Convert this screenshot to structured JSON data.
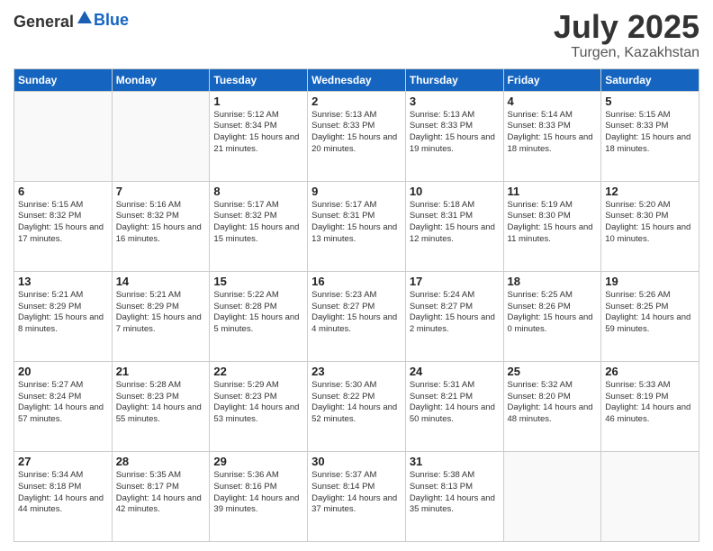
{
  "header": {
    "logo_general": "General",
    "logo_blue": "Blue",
    "month": "July 2025",
    "location": "Turgen, Kazakhstan"
  },
  "days_of_week": [
    "Sunday",
    "Monday",
    "Tuesday",
    "Wednesday",
    "Thursday",
    "Friday",
    "Saturday"
  ],
  "weeks": [
    [
      {
        "day": "",
        "info": ""
      },
      {
        "day": "",
        "info": ""
      },
      {
        "day": "1",
        "info": "Sunrise: 5:12 AM\nSunset: 8:34 PM\nDaylight: 15 hours\nand 21 minutes."
      },
      {
        "day": "2",
        "info": "Sunrise: 5:13 AM\nSunset: 8:33 PM\nDaylight: 15 hours\nand 20 minutes."
      },
      {
        "day": "3",
        "info": "Sunrise: 5:13 AM\nSunset: 8:33 PM\nDaylight: 15 hours\nand 19 minutes."
      },
      {
        "day": "4",
        "info": "Sunrise: 5:14 AM\nSunset: 8:33 PM\nDaylight: 15 hours\nand 18 minutes."
      },
      {
        "day": "5",
        "info": "Sunrise: 5:15 AM\nSunset: 8:33 PM\nDaylight: 15 hours\nand 18 minutes."
      }
    ],
    [
      {
        "day": "6",
        "info": "Sunrise: 5:15 AM\nSunset: 8:32 PM\nDaylight: 15 hours\nand 17 minutes."
      },
      {
        "day": "7",
        "info": "Sunrise: 5:16 AM\nSunset: 8:32 PM\nDaylight: 15 hours\nand 16 minutes."
      },
      {
        "day": "8",
        "info": "Sunrise: 5:17 AM\nSunset: 8:32 PM\nDaylight: 15 hours\nand 15 minutes."
      },
      {
        "day": "9",
        "info": "Sunrise: 5:17 AM\nSunset: 8:31 PM\nDaylight: 15 hours\nand 13 minutes."
      },
      {
        "day": "10",
        "info": "Sunrise: 5:18 AM\nSunset: 8:31 PM\nDaylight: 15 hours\nand 12 minutes."
      },
      {
        "day": "11",
        "info": "Sunrise: 5:19 AM\nSunset: 8:30 PM\nDaylight: 15 hours\nand 11 minutes."
      },
      {
        "day": "12",
        "info": "Sunrise: 5:20 AM\nSunset: 8:30 PM\nDaylight: 15 hours\nand 10 minutes."
      }
    ],
    [
      {
        "day": "13",
        "info": "Sunrise: 5:21 AM\nSunset: 8:29 PM\nDaylight: 15 hours\nand 8 minutes."
      },
      {
        "day": "14",
        "info": "Sunrise: 5:21 AM\nSunset: 8:29 PM\nDaylight: 15 hours\nand 7 minutes."
      },
      {
        "day": "15",
        "info": "Sunrise: 5:22 AM\nSunset: 8:28 PM\nDaylight: 15 hours\nand 5 minutes."
      },
      {
        "day": "16",
        "info": "Sunrise: 5:23 AM\nSunset: 8:27 PM\nDaylight: 15 hours\nand 4 minutes."
      },
      {
        "day": "17",
        "info": "Sunrise: 5:24 AM\nSunset: 8:27 PM\nDaylight: 15 hours\nand 2 minutes."
      },
      {
        "day": "18",
        "info": "Sunrise: 5:25 AM\nSunset: 8:26 PM\nDaylight: 15 hours\nand 0 minutes."
      },
      {
        "day": "19",
        "info": "Sunrise: 5:26 AM\nSunset: 8:25 PM\nDaylight: 14 hours\nand 59 minutes."
      }
    ],
    [
      {
        "day": "20",
        "info": "Sunrise: 5:27 AM\nSunset: 8:24 PM\nDaylight: 14 hours\nand 57 minutes."
      },
      {
        "day": "21",
        "info": "Sunrise: 5:28 AM\nSunset: 8:23 PM\nDaylight: 14 hours\nand 55 minutes."
      },
      {
        "day": "22",
        "info": "Sunrise: 5:29 AM\nSunset: 8:23 PM\nDaylight: 14 hours\nand 53 minutes."
      },
      {
        "day": "23",
        "info": "Sunrise: 5:30 AM\nSunset: 8:22 PM\nDaylight: 14 hours\nand 52 minutes."
      },
      {
        "day": "24",
        "info": "Sunrise: 5:31 AM\nSunset: 8:21 PM\nDaylight: 14 hours\nand 50 minutes."
      },
      {
        "day": "25",
        "info": "Sunrise: 5:32 AM\nSunset: 8:20 PM\nDaylight: 14 hours\nand 48 minutes."
      },
      {
        "day": "26",
        "info": "Sunrise: 5:33 AM\nSunset: 8:19 PM\nDaylight: 14 hours\nand 46 minutes."
      }
    ],
    [
      {
        "day": "27",
        "info": "Sunrise: 5:34 AM\nSunset: 8:18 PM\nDaylight: 14 hours\nand 44 minutes."
      },
      {
        "day": "28",
        "info": "Sunrise: 5:35 AM\nSunset: 8:17 PM\nDaylight: 14 hours\nand 42 minutes."
      },
      {
        "day": "29",
        "info": "Sunrise: 5:36 AM\nSunset: 8:16 PM\nDaylight: 14 hours\nand 39 minutes."
      },
      {
        "day": "30",
        "info": "Sunrise: 5:37 AM\nSunset: 8:14 PM\nDaylight: 14 hours\nand 37 minutes."
      },
      {
        "day": "31",
        "info": "Sunrise: 5:38 AM\nSunset: 8:13 PM\nDaylight: 14 hours\nand 35 minutes."
      },
      {
        "day": "",
        "info": ""
      },
      {
        "day": "",
        "info": ""
      }
    ]
  ]
}
